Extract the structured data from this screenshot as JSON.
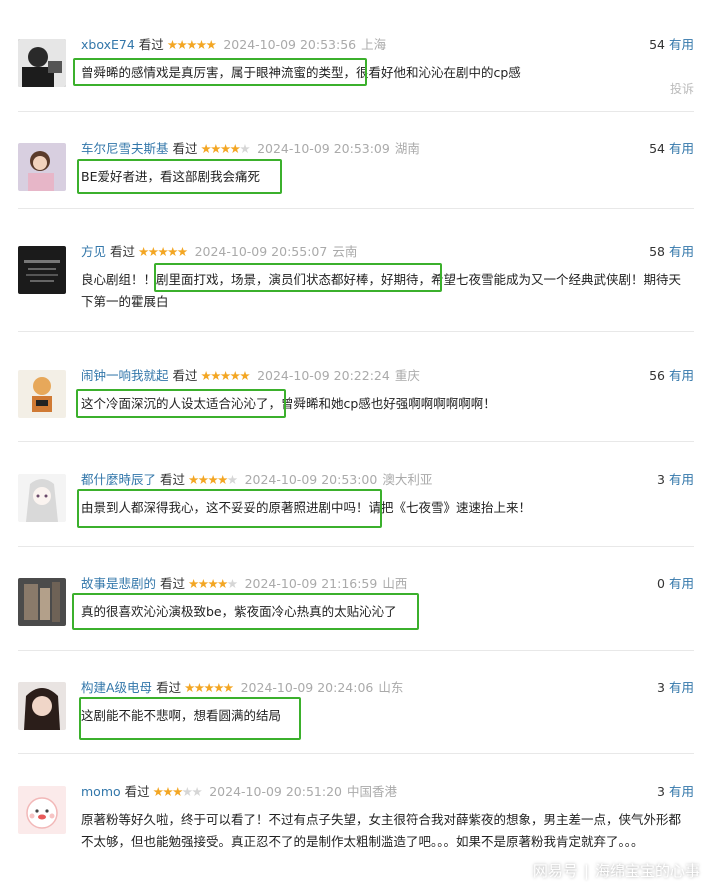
{
  "comments": [
    {
      "user": "xboxE74",
      "watched": "看过",
      "stars": 5,
      "time": "2024-10-09 20:53:56",
      "location": "上海",
      "votes": "54",
      "vote_label": "有用",
      "text": "曾舜晞的感情戏是真厉害，属于眼神流蜜的类型，很看好他和沁沁在剧中的cp感",
      "report": "投诉"
    },
    {
      "user": "车尔尼雪夫斯基",
      "watched": "看过",
      "stars": 4,
      "time": "2024-10-09 20:53:09",
      "location": "湖南",
      "votes": "54",
      "vote_label": "有用",
      "text": "BE爱好者进，看这部剧我会痛死"
    },
    {
      "user": "方见",
      "watched": "看过",
      "stars": 5,
      "time": "2024-10-09 20:55:07",
      "location": "云南",
      "votes": "58",
      "vote_label": "有用",
      "text": "良心剧组！！剧里面打戏，场景，演员们状态都好棒，好期待，希望七夜雪能成为又一个经典武侠剧！期待天下第一的霍展白"
    },
    {
      "user": "闹钟一响我就起",
      "watched": "看过",
      "stars": 5,
      "time": "2024-10-09 20:22:24",
      "location": "重庆",
      "votes": "56",
      "vote_label": "有用",
      "text": "这个冷面深沉的人设太适合沁沁了，曾舜晞和她cp感也好强啊啊啊啊啊啊！"
    },
    {
      "user": "都什麼時辰了",
      "watched": "看过",
      "stars": 4,
      "time": "2024-10-09 20:53:00",
      "location": "澳大利亚",
      "votes": "3",
      "vote_label": "有用",
      "text": "由景到人都深得我心，这不妥妥的原著照进剧中吗！请把《七夜雪》速速抬上来！"
    },
    {
      "user": "故事是悲剧的",
      "watched": "看过",
      "stars": 4,
      "time": "2024-10-09 21:16:59",
      "location": "山西",
      "votes": "0",
      "vote_label": "有用",
      "text": "真的很喜欢沁沁演极致be，紫夜面冷心热真的太贴沁沁了"
    },
    {
      "user": "构建A级电母",
      "watched": "看过",
      "stars": 5,
      "time": "2024-10-09 20:24:06",
      "location": "山东",
      "votes": "3",
      "vote_label": "有用",
      "text": "这剧能不能不悲啊，想看圆满的结局"
    },
    {
      "user": "momo",
      "watched": "看过",
      "stars": 3,
      "time": "2024-10-09 20:51:20",
      "location": "中国香港",
      "votes": "3",
      "vote_label": "有用",
      "text": "原著粉等好久啦，终于可以看了！不过有点子失望，女主很符合我对薛紫夜的想象，男主差一点，侠气外形都不太够，但也能勉强接受。真正忍不了的是制作太粗制滥造了吧。。。如果不是原著粉我肯定就弃了。。。"
    }
  ],
  "watermark": {
    "site": "网易号",
    "author": "海绵宝宝的心事"
  },
  "colors": {
    "username": "#3377aa",
    "star": "#f3a623",
    "highlight": "#3bb02c",
    "meta": "#aaaaaa"
  }
}
